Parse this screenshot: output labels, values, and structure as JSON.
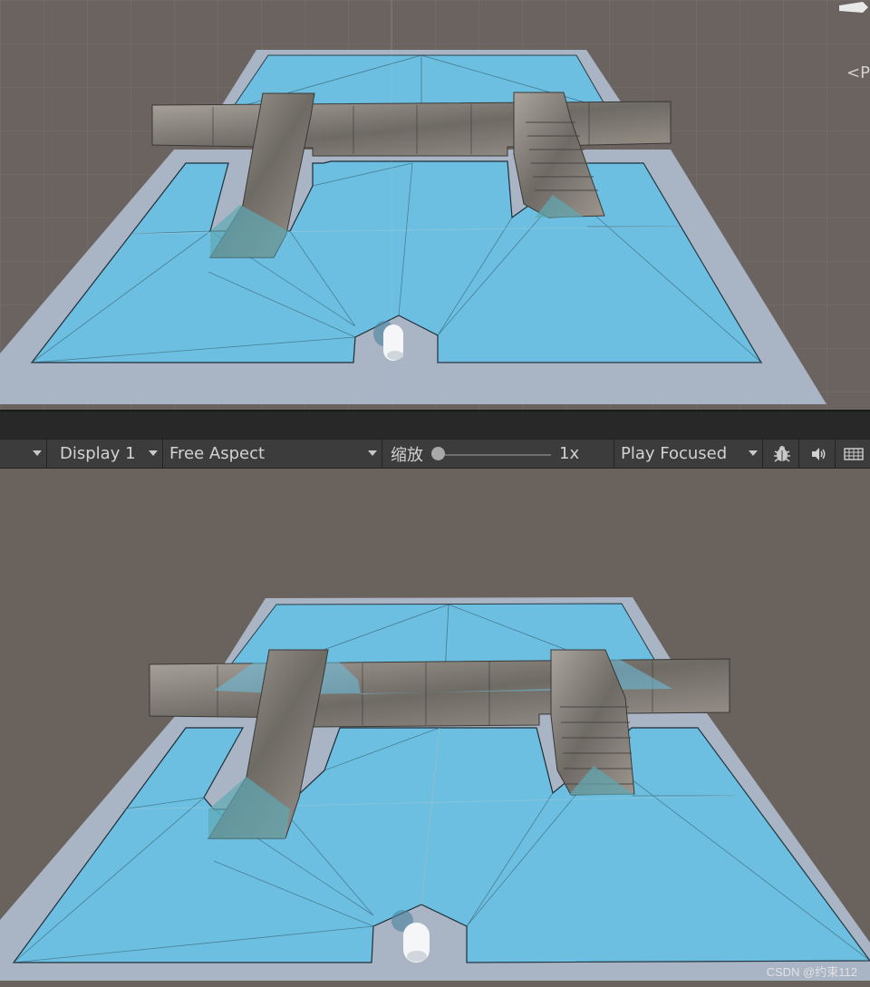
{
  "toolbar": {
    "display_label": "Display 1",
    "aspect_label": "Free Aspect",
    "zoom_label": "缩放",
    "zoom_value": "1x",
    "play_mode_label": "Play Focused"
  },
  "scene_gizmo": {
    "persp_label": "<P"
  },
  "icons": {
    "stats": "bug-icon",
    "mute": "speaker-icon",
    "gizmos": "keyboard-icon"
  },
  "watermark": "CSDN @约束112",
  "colors": {
    "navmesh": "#6cbfe0",
    "walkable_border": "#a9b4c4",
    "wall_stone": "#8f8a84",
    "editor_bg": "#6b6360",
    "toolbar_bg": "#3c3c3c"
  }
}
